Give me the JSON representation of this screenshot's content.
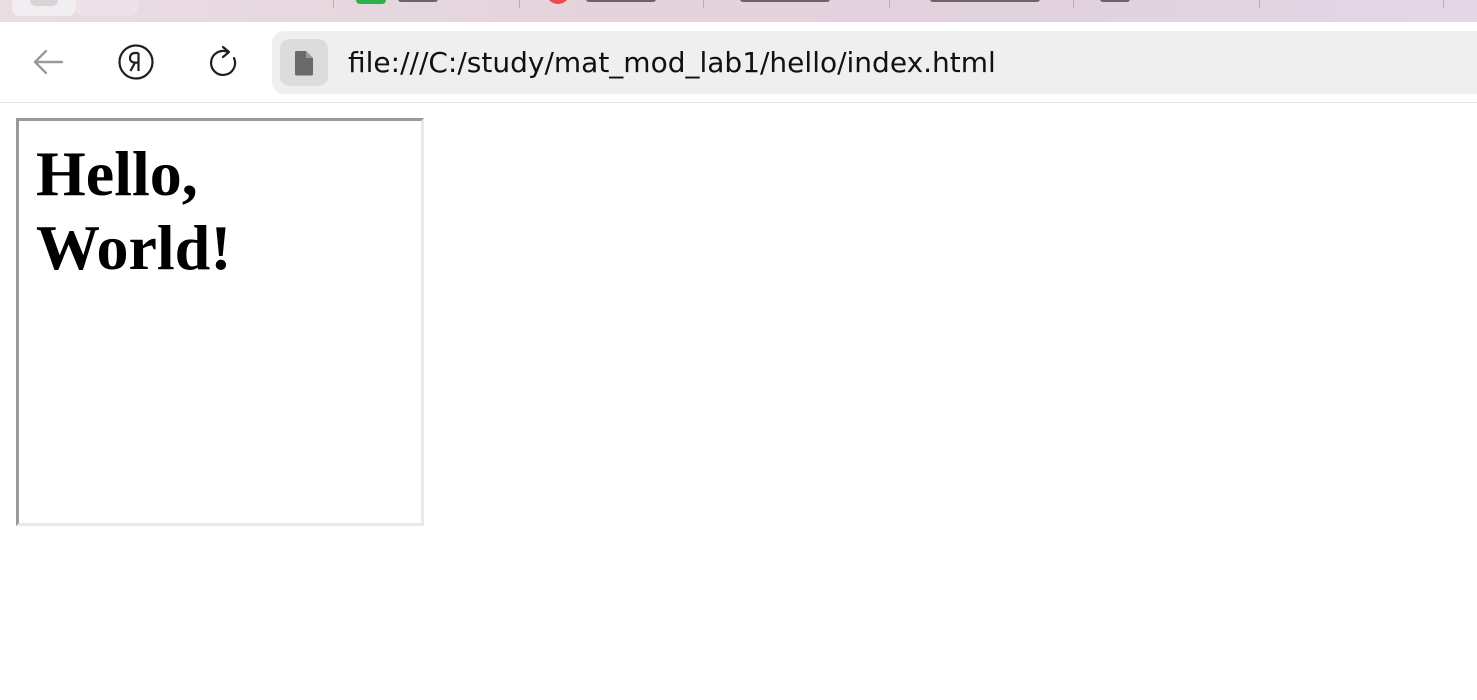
{
  "browser": {
    "address_bar": {
      "url": "file:///C:/study/mat_mod_lab1/hello/index.html"
    },
    "icons": {
      "back": "arrow-left-icon",
      "yandex": "yandex-logo-icon",
      "reload": "reload-icon",
      "site_info": "file-icon"
    },
    "colors": {
      "tab_favicon_green": "#27b34a",
      "tab_favicon_red": "#f04a4a"
    }
  },
  "page": {
    "heading": "Hello, World!"
  }
}
